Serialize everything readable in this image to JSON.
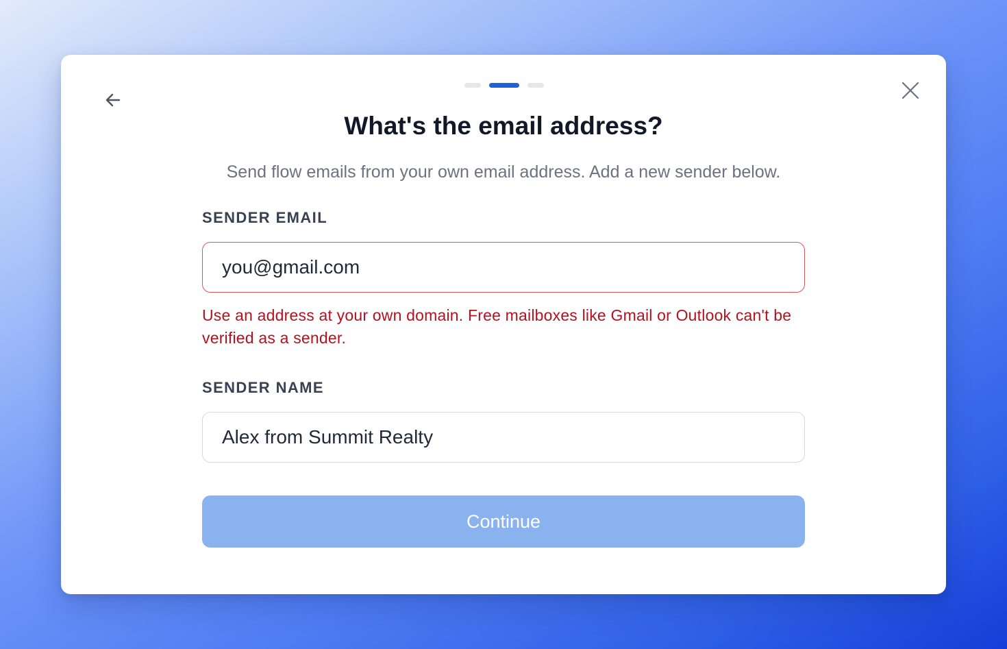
{
  "stepper": {
    "total_steps": 3,
    "current_step": 2
  },
  "dialog": {
    "title": "What's the email address?",
    "subtitle": "Send flow emails from your own email address. Add a new sender below."
  },
  "form": {
    "email_label": "SENDER EMAIL",
    "email_value": "you@gmail.com",
    "email_error": "Use an address at your own domain. Free mailboxes like Gmail or Outlook can't be verified as a sender.",
    "name_label": "SENDER NAME",
    "name_value": "Alex from Summit Realty",
    "continue_label": "Continue"
  },
  "icons": {
    "back": "arrow-left-icon",
    "close": "close-icon"
  },
  "colors": {
    "accent": "#1f63d6",
    "button_disabled": "#8ab2ee",
    "error": "#b3121f",
    "error_border": "#e0525a",
    "title": "#111827",
    "subtitle": "#6b7280"
  }
}
